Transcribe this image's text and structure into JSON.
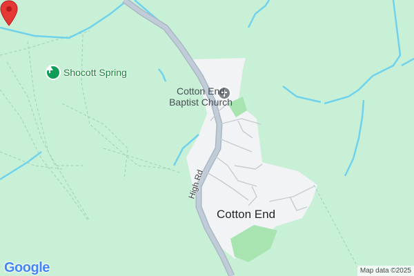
{
  "map": {
    "colors": {
      "land": "#c8f0d6",
      "urban": "#f1f3f4",
      "water": "#6fd2ec",
      "road": "#c0ccd8",
      "road_edge": "#aab7c4",
      "park": "#a8e4b0",
      "path": "#a3d6b9",
      "pin": "#e53935"
    },
    "poi": {
      "name": "Shocott Spring",
      "icon": "tree-icon"
    },
    "church": {
      "name_line1": "Cotton End",
      "name_line2": "Baptist Church",
      "icon": "cross-icon"
    },
    "road_label": "High Rd",
    "town_label": "Cotton End",
    "pin_icon": "location-pin-icon",
    "logo": "Google",
    "attribution": "Map data ©2025"
  }
}
